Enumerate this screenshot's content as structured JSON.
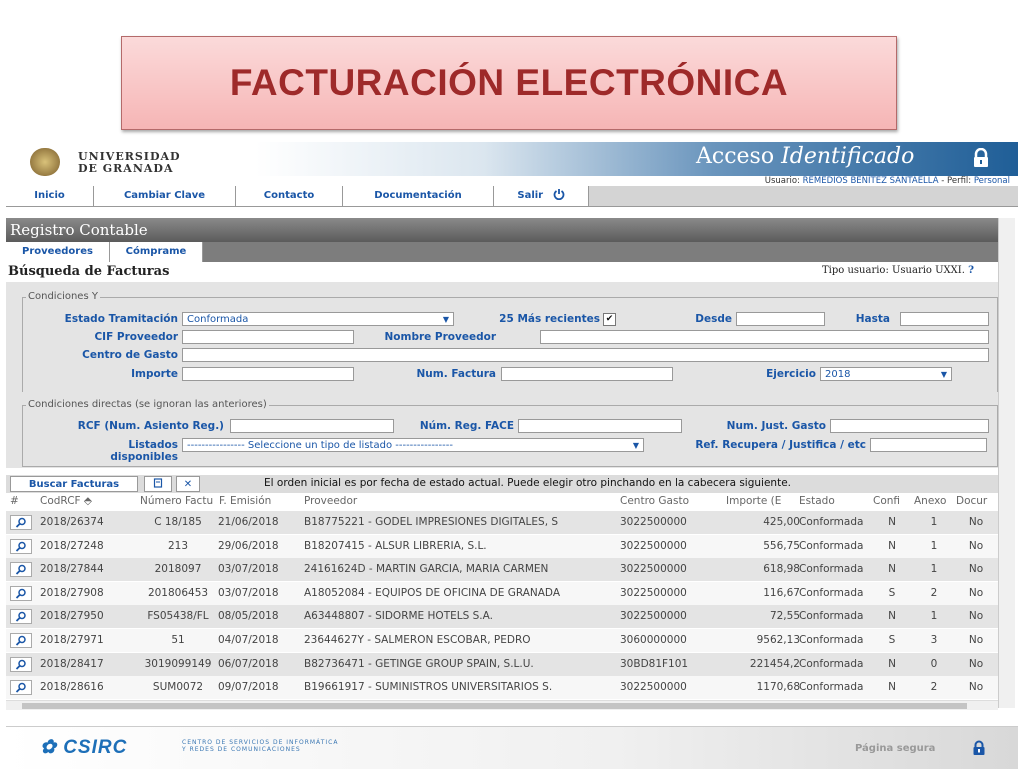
{
  "slide_title": "FACTURACIÓN ELECTRÓNICA",
  "header": {
    "university_line1": "UNIVERSIDAD",
    "university_line2": "DE GRANADA",
    "access_prefix": "Acceso",
    "access_italic": "Identificado",
    "user_label": "Usuario:",
    "user_name": "REMEDIOS BENÍTEZ SANTAELLA",
    "profile_label": "- Perfil:",
    "profile_value": "Personal"
  },
  "menu": {
    "inicio": "Inicio",
    "cambiar_clave": "Cambiar Clave",
    "contacto": "Contacto",
    "documentacion": "Documentación",
    "salir": "Salir"
  },
  "section_title": "Registro Contable",
  "tabs": {
    "proveedores": "Proveedores",
    "comprame": "Cómprame"
  },
  "search_title": "Búsqueda de Facturas",
  "tipo_usuario": {
    "label": "Tipo usuario: Usuario UXXI.",
    "help": "?"
  },
  "conditions": {
    "legend": "Condiciones Y",
    "estado_label": "Estado Tramitación",
    "estado_value": "Conformada",
    "recientes_label": "25 Más recientes",
    "desde_label": "Desde",
    "hasta_label": "Hasta",
    "cif_label": "CIF Proveedor",
    "nombre_label": "Nombre Proveedor",
    "centro_label": "Centro de Gasto",
    "importe_label": "Importe",
    "num_factura_label": "Num. Factura",
    "ejercicio_label": "Ejercicio",
    "ejercicio_value": "2018"
  },
  "direct": {
    "legend": "Condiciones directas (se ignoran las anteriores)",
    "rcf_label": "RCF (Num. Asiento Reg.)",
    "face_label": "Núm. Reg. FACE",
    "just_label": "Num. Just. Gasto",
    "listados_label1": "Listados",
    "listados_label2": "disponibles",
    "listados_value": "---------------- Seleccione un tipo de listado ----------------",
    "ref_label": "Ref. Recupera / Justifica / etc"
  },
  "toolbar": {
    "buscar": "Buscar Facturas",
    "order_msg": "El orden inicial es por fecha de estado actual. Puede elegir otro pinchando en la cabecera siguiente."
  },
  "table": {
    "headers": [
      "#",
      "CodRCF ⬘",
      "Número Factu",
      "F. Emisión",
      "Proveedor",
      "Centro Gasto",
      "Importe (E",
      "Estado",
      "Confi",
      "Anexo",
      "Docur"
    ],
    "rows": [
      [
        "2018/26374",
        "C 18/185",
        "21/06/2018",
        "B18775221 - GODEL IMPRESIONES DIGITALES, S",
        "3022500000",
        "425,00",
        "Conformada",
        "N",
        "1",
        "No"
      ],
      [
        "2018/27248",
        "213",
        "29/06/2018",
        "B18207415 - ALSUR LIBRERIA, S.L.",
        "3022500000",
        "556,75",
        "Conformada",
        "N",
        "1",
        "No"
      ],
      [
        "2018/27844",
        "2018097",
        "03/07/2018",
        "24161624D - MARTIN GARCIA, MARIA CARMEN",
        "3022500000",
        "618,98",
        "Conformada",
        "N",
        "1",
        "No"
      ],
      [
        "2018/27908",
        "201806453",
        "03/07/2018",
        "A18052084 - EQUIPOS DE OFICINA DE GRANADA",
        "3022500000",
        "116,67",
        "Conformada",
        "S",
        "2",
        "No"
      ],
      [
        "2018/27950",
        "FS05438/FL",
        "08/05/2018",
        "A63448807 - SIDORME HOTELS S.A.",
        "3022500000",
        "72,55",
        "Conformada",
        "N",
        "1",
        "No"
      ],
      [
        "2018/27971",
        "51",
        "04/07/2018",
        "23644627Y - SALMERON ESCOBAR, PEDRO",
        "3060000000",
        "9562,13",
        "Conformada",
        "S",
        "3",
        "No"
      ],
      [
        "2018/28417",
        "3019099149",
        "06/07/2018",
        "B82736471 - GETINGE GROUP SPAIN, S.L.U.",
        "30BD81F101",
        "221454,2",
        "Conformada",
        "N",
        "0",
        "No"
      ],
      [
        "2018/28616",
        "SUM0072",
        "09/07/2018",
        "B19661917 - SUMINISTROS UNIVERSITARIOS S.",
        "3022500000",
        "1170,68",
        "Conformada",
        "N",
        "2",
        "No"
      ]
    ]
  },
  "footer": {
    "logo": "CSIRC",
    "sub1": "CENTRO DE SERVICIOS DE INFORMÁTICA",
    "sub2": "Y REDES DE COMUNICACIONES",
    "pagina_segura": "Página segura"
  },
  "colors": {
    "accent": "#1a56a7",
    "title": "#9e2a2a",
    "header_blue": "#1f5e97"
  }
}
